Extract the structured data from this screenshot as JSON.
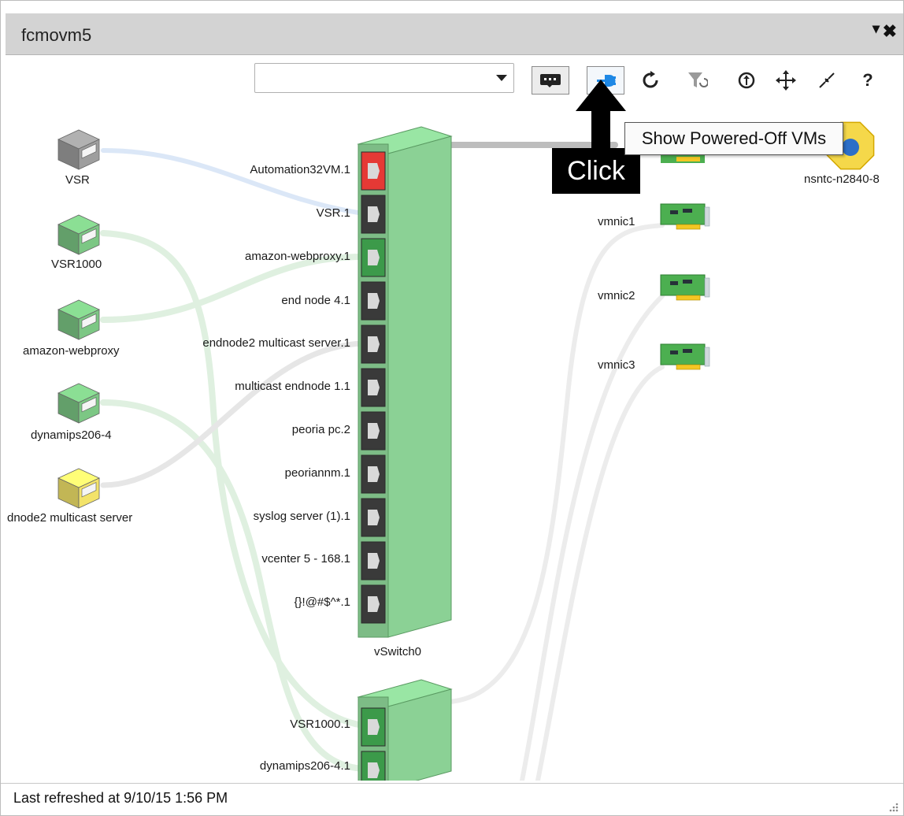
{
  "window": {
    "title": "fcmovm5",
    "menu_icon": "chevron-down-icon",
    "close_icon": "close-icon"
  },
  "toolbar": {
    "filter_value": "",
    "buttons": [
      {
        "name": "show-labels",
        "icon": "label-icon"
      },
      {
        "name": "show-powered-off-vms",
        "icon": "plug-icon"
      },
      {
        "name": "refresh",
        "icon": "refresh-icon"
      },
      {
        "name": "reset-filter",
        "icon": "filter-reset-icon"
      },
      {
        "name": "zoom-in",
        "icon": "zoom-plus-icon"
      },
      {
        "name": "pan",
        "icon": "move-icon"
      },
      {
        "name": "collapse",
        "icon": "collapse-icon"
      },
      {
        "name": "help",
        "label": "?",
        "icon": "help-icon"
      }
    ]
  },
  "annotation": {
    "callout": "Click",
    "tooltip": "Show Powered-Off VMs"
  },
  "vms": [
    {
      "label": "VSR",
      "state": "unknown",
      "color": "#9e9e9e"
    },
    {
      "label": "VSR1000",
      "state": "on",
      "color": "#7cc784"
    },
    {
      "label": "amazon-webproxy",
      "state": "on",
      "color": "#7cc784"
    },
    {
      "label": "dynamips206-4",
      "state": "on",
      "color": "#7cc784"
    },
    {
      "label": "dnode2 multicast server",
      "state": "warning",
      "color": "#f3e36a"
    }
  ],
  "vswitch0": {
    "label": "vSwitch0",
    "color": "#8bd195",
    "ports": [
      {
        "label": "Automation32VM.1",
        "status": "down",
        "color": "#e53935"
      },
      {
        "label": "VSR.1",
        "status": "up"
      },
      {
        "label": "amazon-webproxy.1",
        "status": "active"
      },
      {
        "label": "end node 4.1",
        "status": "up"
      },
      {
        "label": "endnode2 multicast server.1",
        "status": "up"
      },
      {
        "label": "multicast endnode 1.1",
        "status": "up"
      },
      {
        "label": "peoria pc.2",
        "status": "up"
      },
      {
        "label": "peoriannm.1",
        "status": "up"
      },
      {
        "label": "syslog server (1).1",
        "status": "up"
      },
      {
        "label": "vcenter 5 - 168.1",
        "status": "up"
      },
      {
        "label": "{}!@#$^*.1",
        "status": "up"
      }
    ]
  },
  "vswitch1": {
    "ports": [
      {
        "label": "VSR1000.1",
        "status": "active"
      },
      {
        "label": "dynamips206-4.1",
        "status": "active"
      }
    ]
  },
  "nics": [
    {
      "label": "vmnic1"
    },
    {
      "label": "vmnic2"
    },
    {
      "label": "vmnic3"
    }
  ],
  "host": {
    "label": "nsntc-n2840-8",
    "color": "#f5d84a"
  },
  "footer": {
    "status": "Last refreshed at 9/10/15 1:56 PM"
  }
}
